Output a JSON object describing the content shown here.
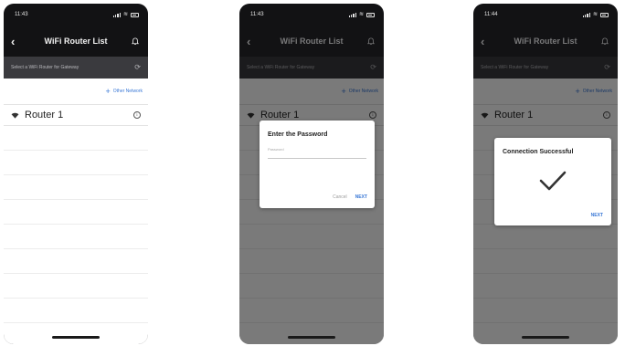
{
  "common": {
    "nav_title": "WiFi Router List",
    "subhead": "Select a WiFi Router for Gateway",
    "other_network": "Other Network",
    "router_name": "Router 1"
  },
  "screens": [
    {
      "time": "11:43"
    },
    {
      "time": "11:43"
    },
    {
      "time": "11:44"
    }
  ],
  "password_dialog": {
    "title": "Enter the Password",
    "label": "Password",
    "cancel": "Cancel",
    "next": "NEXT"
  },
  "success_dialog": {
    "title": "Connection Successful",
    "next": "NEXT"
  },
  "colors": {
    "accent": "#3a78d6",
    "phone_frame": "#121214",
    "subhead_bg": "#3a3a3e"
  },
  "icons": [
    "back-arrow-icon",
    "bell-icon",
    "refresh-icon",
    "plus-icon",
    "wifi-icon",
    "info-icon",
    "checkmark-icon"
  ]
}
